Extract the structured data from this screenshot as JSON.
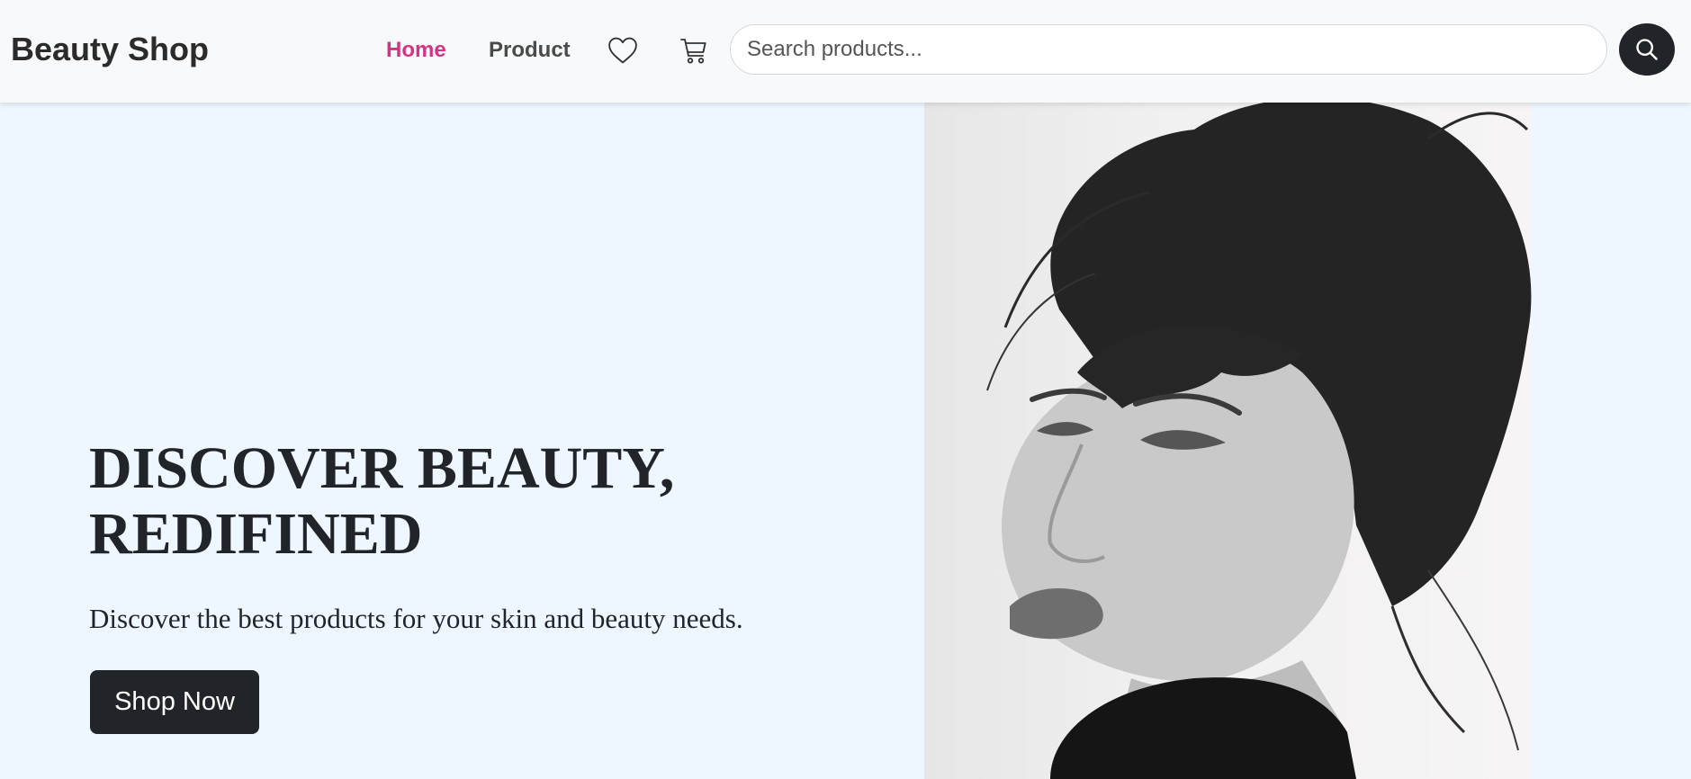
{
  "brand": "Beauty Shop",
  "nav": {
    "home": "Home",
    "product": "Product"
  },
  "icons": {
    "wishlist": "heart-icon",
    "cart": "cart-icon",
    "search": "search-icon"
  },
  "search": {
    "placeholder": "Search products..."
  },
  "hero": {
    "title_line1": "DISCOVER BEAUTY,",
    "title_line2": "REDIFINED",
    "subtitle": "Discover the best products for your skin and beauty needs.",
    "cta": "Shop Now"
  },
  "colors": {
    "accent": "#d63384",
    "dark": "#212529",
    "hero_bg": "#eef6ff",
    "navbar_bg": "#f8f9fa"
  }
}
